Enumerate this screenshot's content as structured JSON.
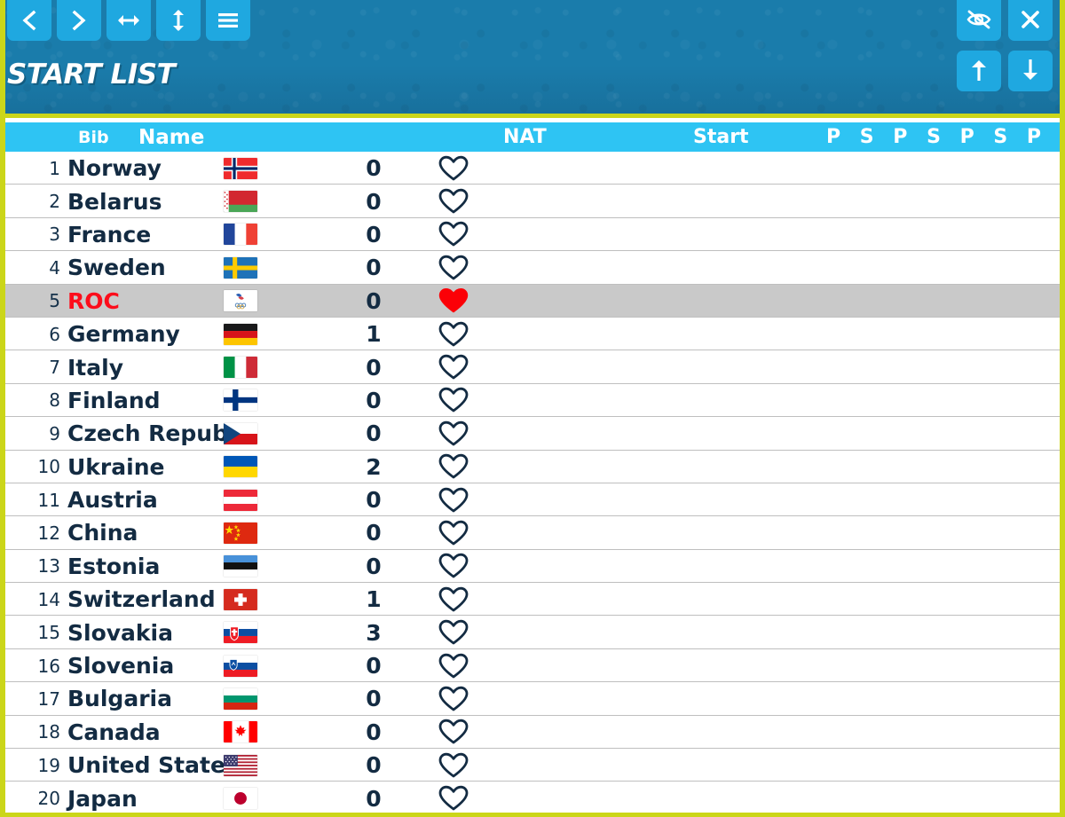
{
  "window": {
    "title": "START LIST",
    "accent_blue": "#1fa8e0",
    "header_blue": "#1a7cab",
    "table_header_blue": "#2ec4f3",
    "frame_yellow": "#cbd619",
    "selected_row_bg": "#c9c9c9",
    "selected_text_red": "#fc0d1b",
    "text_navy": "#132b42"
  },
  "toolbar": {
    "left_buttons": [
      {
        "name": "prev-button",
        "icon": "chevron-left-icon"
      },
      {
        "name": "next-button",
        "icon": "chevron-right-icon"
      },
      {
        "name": "resize-width-button",
        "icon": "arrows-horizontal-icon"
      },
      {
        "name": "resize-height-button",
        "icon": "arrows-vertical-icon"
      },
      {
        "name": "menu-button",
        "icon": "hamburger-menu-icon"
      }
    ],
    "right_buttons_top": [
      {
        "name": "hide-button",
        "icon": "eye-off-icon"
      },
      {
        "name": "close-button",
        "icon": "close-x-icon"
      }
    ],
    "right_buttons_bottom": [
      {
        "name": "scroll-up-button",
        "icon": "arrow-up-icon"
      },
      {
        "name": "scroll-down-button",
        "icon": "arrow-down-icon"
      }
    ]
  },
  "table": {
    "headers": {
      "bib": "Bib",
      "name": "Name",
      "nat": "NAT",
      "start": "Start",
      "ps": "P S P S P S P S"
    },
    "rows": [
      {
        "bib": "1",
        "name": "Norway",
        "flag": "no",
        "num": "0",
        "selected": false,
        "heart": "heart-outline"
      },
      {
        "bib": "2",
        "name": "Belarus",
        "flag": "by",
        "num": "0",
        "selected": false,
        "heart": "heart-outline"
      },
      {
        "bib": "3",
        "name": "France",
        "flag": "fr",
        "num": "0",
        "selected": false,
        "heart": "heart-outline"
      },
      {
        "bib": "4",
        "name": "Sweden",
        "flag": "se",
        "num": "0",
        "selected": false,
        "heart": "heart-outline"
      },
      {
        "bib": "5",
        "name": "ROC",
        "flag": "roc",
        "num": "0",
        "selected": true,
        "heart": "heart-filled"
      },
      {
        "bib": "6",
        "name": "Germany",
        "flag": "de",
        "num": "1",
        "selected": false,
        "heart": "heart-outline"
      },
      {
        "bib": "7",
        "name": "Italy",
        "flag": "it",
        "num": "0",
        "selected": false,
        "heart": "heart-outline"
      },
      {
        "bib": "8",
        "name": "Finland",
        "flag": "fi",
        "num": "0",
        "selected": false,
        "heart": "heart-outline"
      },
      {
        "bib": "9",
        "name": "Czech Republic",
        "flag": "cz",
        "num": "0",
        "selected": false,
        "heart": "heart-outline"
      },
      {
        "bib": "10",
        "name": "Ukraine",
        "flag": "ua",
        "num": "2",
        "selected": false,
        "heart": "heart-outline"
      },
      {
        "bib": "11",
        "name": "Austria",
        "flag": "at",
        "num": "0",
        "selected": false,
        "heart": "heart-outline"
      },
      {
        "bib": "12",
        "name": "China",
        "flag": "cn",
        "num": "0",
        "selected": false,
        "heart": "heart-outline"
      },
      {
        "bib": "13",
        "name": "Estonia",
        "flag": "ee",
        "num": "0",
        "selected": false,
        "heart": "heart-outline"
      },
      {
        "bib": "14",
        "name": "Switzerland",
        "flag": "ch",
        "num": "1",
        "selected": false,
        "heart": "heart-outline"
      },
      {
        "bib": "15",
        "name": "Slovakia",
        "flag": "sk",
        "num": "3",
        "selected": false,
        "heart": "heart-outline"
      },
      {
        "bib": "16",
        "name": "Slovenia",
        "flag": "si",
        "num": "0",
        "selected": false,
        "heart": "heart-outline"
      },
      {
        "bib": "17",
        "name": "Bulgaria",
        "flag": "bg",
        "num": "0",
        "selected": false,
        "heart": "heart-outline"
      },
      {
        "bib": "18",
        "name": "Canada",
        "flag": "ca",
        "num": "0",
        "selected": false,
        "heart": "heart-outline"
      },
      {
        "bib": "19",
        "name": "United States",
        "flag": "us",
        "num": "0",
        "selected": false,
        "heart": "heart-outline"
      },
      {
        "bib": "20",
        "name": "Japan",
        "flag": "jp",
        "num": "0",
        "selected": false,
        "heart": "heart-outline"
      }
    ]
  }
}
